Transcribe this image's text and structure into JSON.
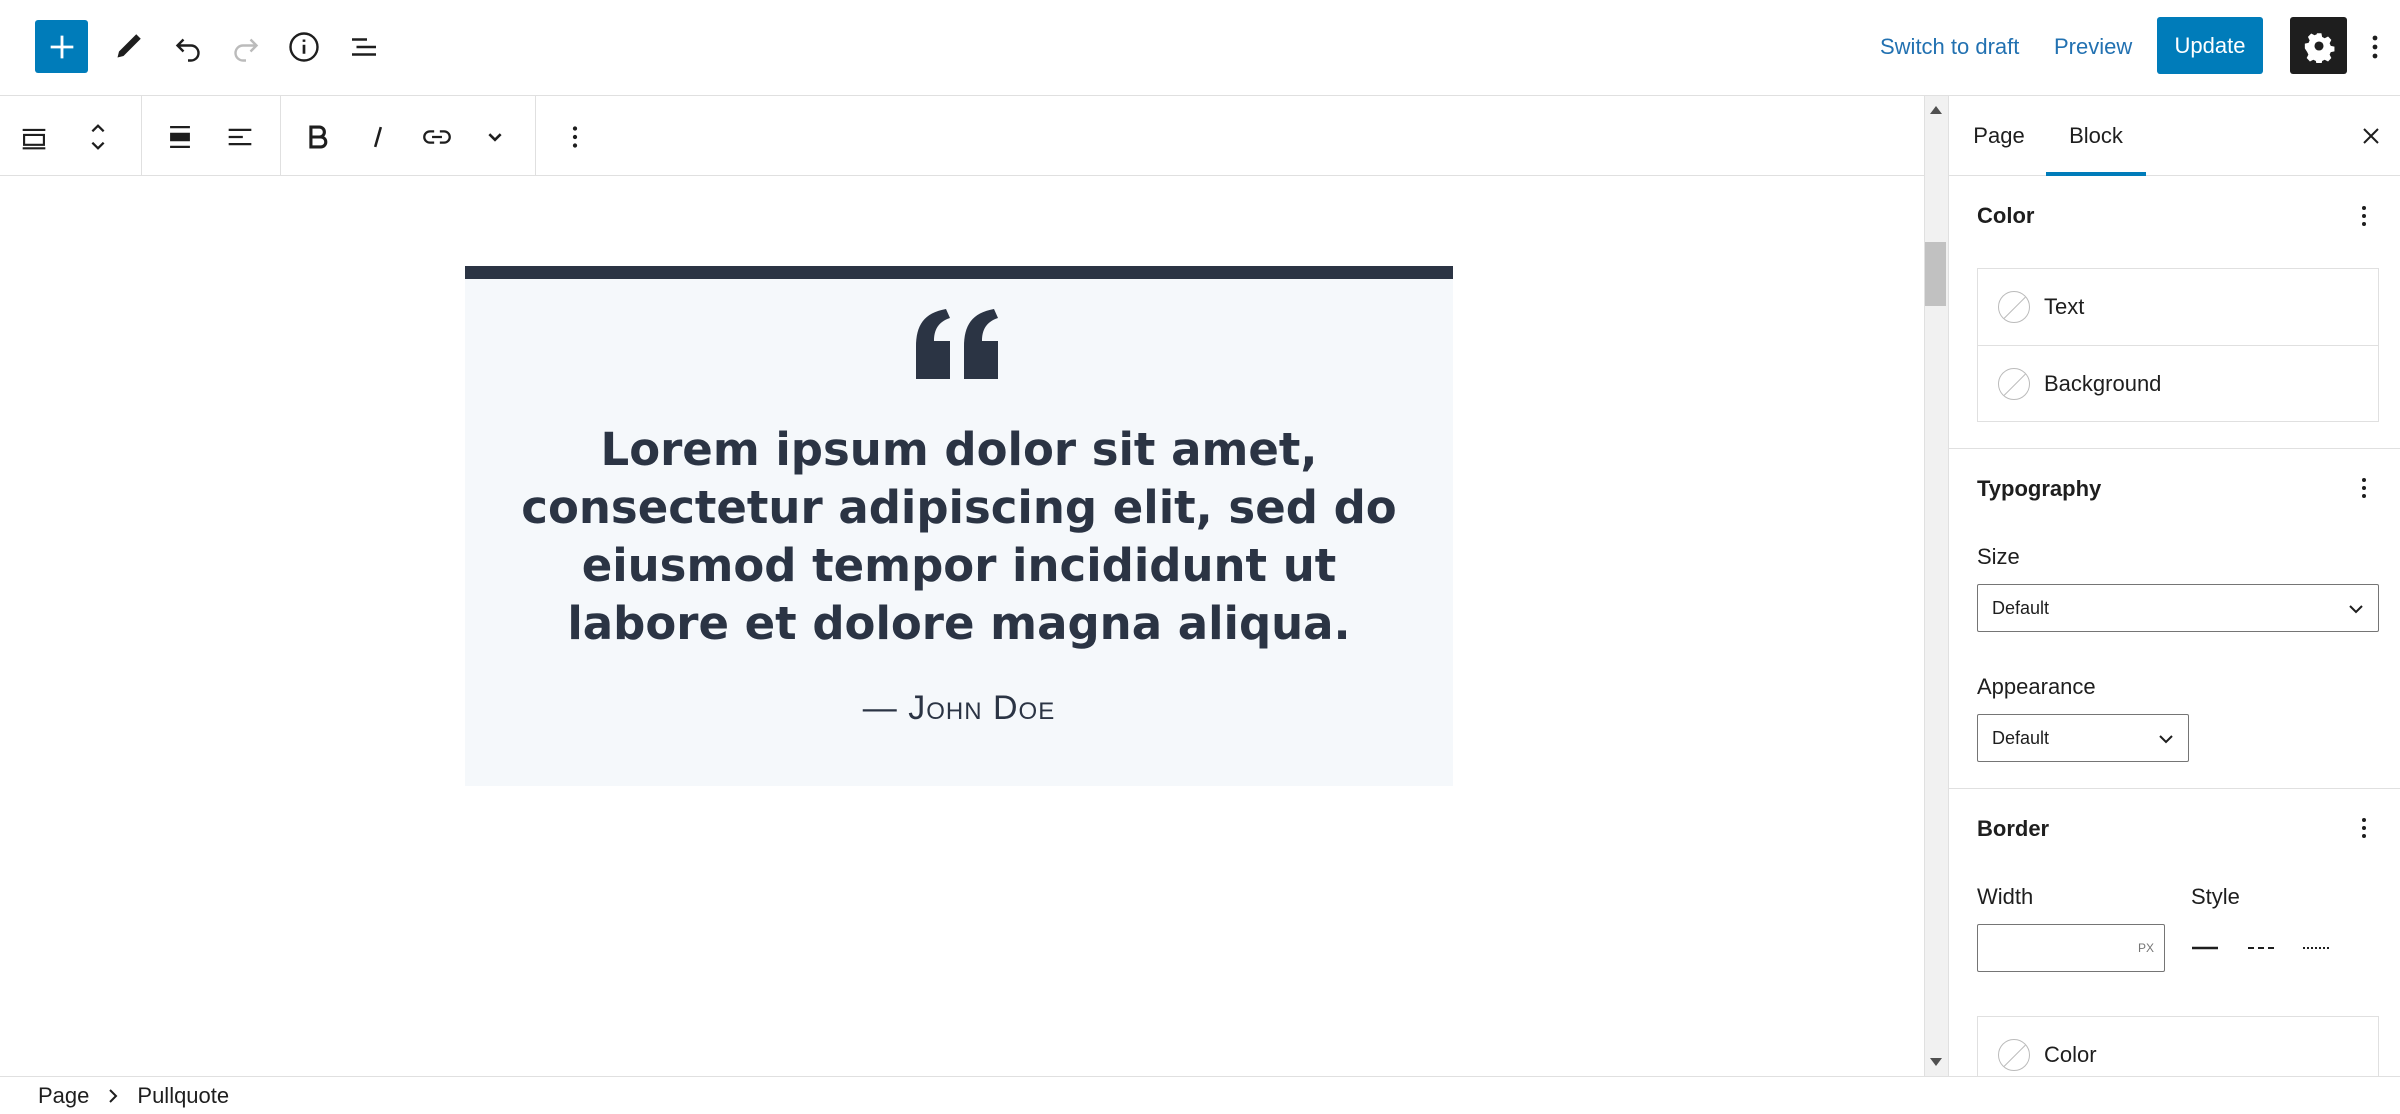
{
  "header": {
    "inserter_icon": "plus-icon",
    "tools_icon": "pencil-icon",
    "undo_icon": "undo-icon",
    "redo_icon": "redo-icon",
    "details_icon": "info-icon",
    "list_view_icon": "list-view-icon",
    "switch_to_draft": "Switch to draft",
    "preview": "Preview",
    "update": "Update",
    "settings_icon": "gear-icon",
    "options_icon": "more-vertical-icon",
    "accent": "#007cba",
    "link_color": "#2271b1"
  },
  "block_toolbar": {
    "items": [
      "block-type-icon",
      "move-up-down-icon",
      "align-wide-icon",
      "text-align-left-icon",
      "bold-icon",
      "italic-icon",
      "link-icon",
      "chevron-down-icon",
      "more-vertical-icon"
    ]
  },
  "pullquote": {
    "quote": "Lorem ipsum dolor sit amet, consectetur adipiscing elit, sed do eiusmod tempor incididunt ut labore et dolore magna aliqua.",
    "citation": "— John Doe",
    "border_color": "#2b3444",
    "background": "#f5f8fb"
  },
  "sidebar": {
    "tabs": [
      {
        "label": "Page"
      },
      {
        "label": "Block"
      }
    ],
    "active_tab": "Block",
    "color": {
      "title": "Color",
      "items": [
        {
          "label": "Text"
        },
        {
          "label": "Background"
        }
      ]
    },
    "typography": {
      "title": "Typography",
      "size_label": "Size",
      "size_value": "Default",
      "appearance_label": "Appearance",
      "appearance_value": "Default"
    },
    "border": {
      "title": "Border",
      "width_label": "Width",
      "width_unit": "PX",
      "style_label": "Style",
      "styles": [
        "solid",
        "dashed",
        "dotted"
      ],
      "color_label": "Color"
    }
  },
  "footer": {
    "breadcrumbs": [
      "Page",
      "Pullquote"
    ]
  }
}
